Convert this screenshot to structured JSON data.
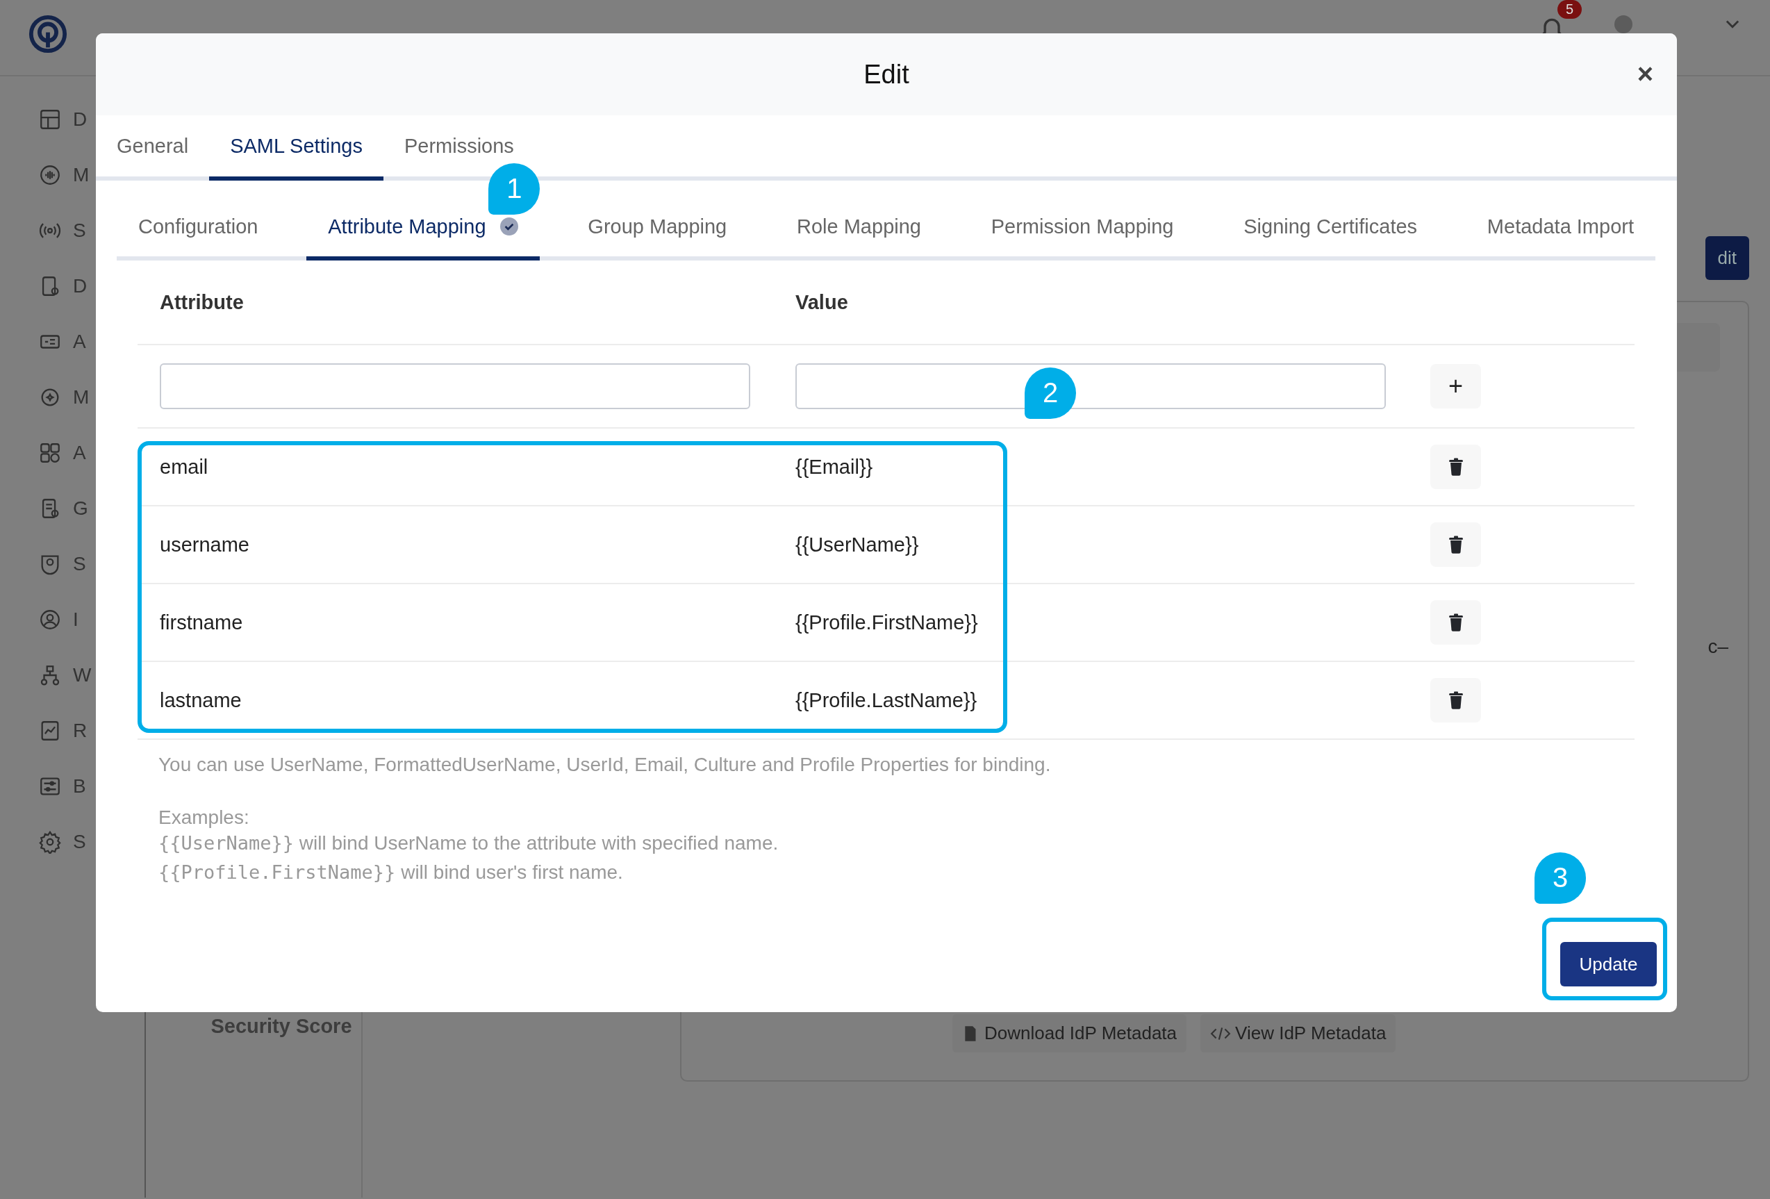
{
  "backdrop": {
    "notification_count": "5",
    "sidebar_letters": [
      "D",
      "M",
      "S",
      "D",
      "A",
      "M",
      "A",
      "G",
      "S",
      "I",
      "W",
      "R",
      "B",
      "S"
    ],
    "action_button": "dit",
    "card_text": "c–",
    "security_label": "Security Score",
    "buttons": [
      "Download IdP Metadata",
      "View IdP Metadata"
    ]
  },
  "modal": {
    "title": "Edit",
    "close": "×",
    "tabs": [
      {
        "label": "General",
        "selected": false
      },
      {
        "label": "SAML Settings",
        "selected": true
      },
      {
        "label": "Permissions",
        "selected": false
      }
    ],
    "subtabs": [
      {
        "label": "Configuration",
        "selected": false,
        "checked": false
      },
      {
        "label": "Attribute Mapping",
        "selected": true,
        "checked": true
      },
      {
        "label": "Group Mapping",
        "selected": false,
        "checked": false
      },
      {
        "label": "Role Mapping",
        "selected": false,
        "checked": false
      },
      {
        "label": "Permission Mapping",
        "selected": false,
        "checked": false
      },
      {
        "label": "Signing Certificates",
        "selected": false,
        "checked": false
      },
      {
        "label": "Metadata Import",
        "selected": false,
        "checked": false
      }
    ],
    "table": {
      "columns": [
        "Attribute",
        "Value"
      ],
      "add_button": "+",
      "rows": [
        {
          "attribute": "email",
          "value": "{{Email}}"
        },
        {
          "attribute": "username",
          "value": "{{UserName}}"
        },
        {
          "attribute": "firstname",
          "value": "{{Profile.FirstName}}"
        },
        {
          "attribute": "lastname",
          "value": "{{Profile.LastName}}"
        }
      ]
    },
    "help": "You can use UserName, FormattedUserName, UserId, Email, Culture and Profile Properties for binding.",
    "examples_label": "Examples:",
    "examples": [
      {
        "code": "{{UserName}}",
        "text": "will bind UserName to the attribute with specified name."
      },
      {
        "code": "{{Profile.FirstName}}",
        "text": "will bind user's first name."
      }
    ],
    "update_button": "Update"
  },
  "callouts": [
    "1",
    "2",
    "3"
  ]
}
